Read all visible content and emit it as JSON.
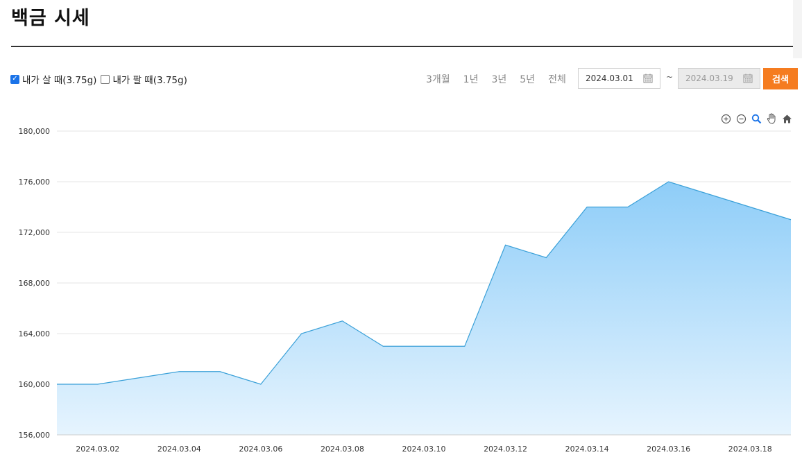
{
  "page": {
    "title": "백금 시세"
  },
  "options": {
    "buy_label": "내가 살 때(3.75g)",
    "buy_checked": true,
    "sell_label": "내가 팔 때(3.75g)",
    "sell_checked": false
  },
  "ranges": [
    "3개월",
    "1년",
    "3년",
    "5년",
    "전체"
  ],
  "date_range": {
    "start": "2024.03.01",
    "separator": "~",
    "end": "2024.03.19",
    "search_label": "검색"
  },
  "toolbar": {
    "icons": [
      "zoom-in-icon",
      "zoom-out-icon",
      "magnify-icon",
      "pan-hand-icon",
      "home-icon"
    ]
  },
  "colors": {
    "accent": "#f57c20",
    "line": "#3aa0d8",
    "area_top": "#8ecdf8",
    "area_bottom": "#e6f4fe"
  },
  "chart_data": {
    "type": "area",
    "x": [
      "2024.03.01",
      "2024.03.02",
      "2024.03.03",
      "2024.03.04",
      "2024.03.05",
      "2024.03.06",
      "2024.03.07",
      "2024.03.08",
      "2024.03.09",
      "2024.03.10",
      "2024.03.11",
      "2024.03.12",
      "2024.03.13",
      "2024.03.14",
      "2024.03.15",
      "2024.03.16",
      "2024.03.17",
      "2024.03.18",
      "2024.03.19"
    ],
    "series": [
      {
        "values": [
          160000,
          160000,
          160500,
          161000,
          161000,
          160000,
          164000,
          165000,
          163000,
          163000,
          163000,
          171000,
          170000,
          174000,
          174000,
          176000,
          175000,
          174000,
          173000
        ]
      }
    ],
    "x_tick_labels": [
      "2024.03.02",
      "2024.03.04",
      "2024.03.06",
      "2024.03.08",
      "2024.03.10",
      "2024.03.12",
      "2024.03.14",
      "2024.03.16",
      "2024.03.18"
    ],
    "y_ticks": [
      "156,000",
      "160,000",
      "164,000",
      "168,000",
      "172,000",
      "176,000",
      "180,000"
    ],
    "ylim": [
      156000,
      180000
    ],
    "grid": true,
    "legend": "none"
  }
}
